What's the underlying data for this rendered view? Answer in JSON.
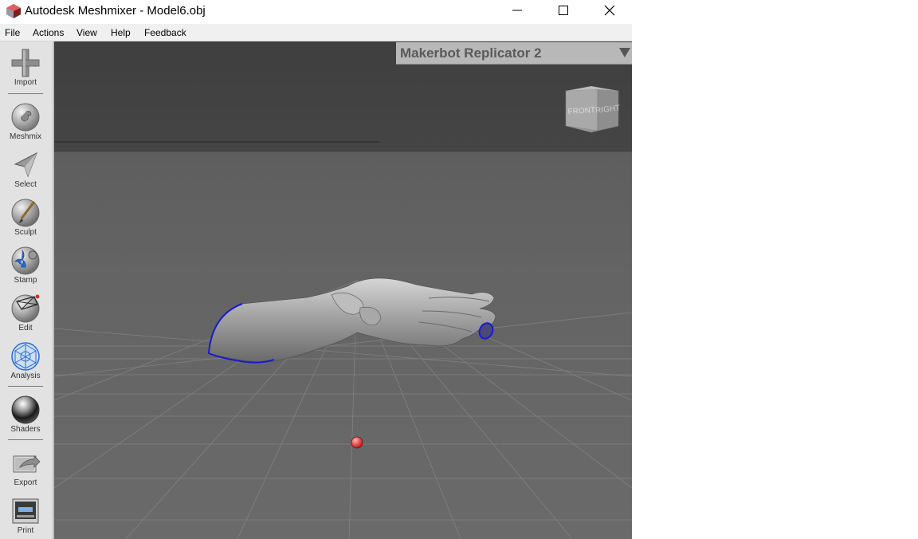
{
  "window": {
    "title": "Autodesk Meshmixer - Model6.obj",
    "controls": [
      "minimize-icon",
      "maximize-icon",
      "close-icon"
    ]
  },
  "menu": {
    "items": [
      "File",
      "Actions",
      "View",
      "Help",
      "Feedback"
    ]
  },
  "toolbar": {
    "tools": [
      {
        "label": "Import",
        "icon": "plus-icon"
      },
      {
        "label": "Meshmix",
        "icon": "bunny-sphere-icon"
      },
      {
        "label": "Select",
        "icon": "arrow-cursor-icon"
      },
      {
        "label": "Sculpt",
        "icon": "brush-sphere-icon"
      },
      {
        "label": "Stamp",
        "icon": "fleur-de-lis-icon"
      },
      {
        "label": "Edit",
        "icon": "mesh-edit-icon"
      },
      {
        "label": "Analysis",
        "icon": "geodesic-sphere-icon"
      },
      {
        "label": "Shaders",
        "icon": "chrome-sphere-icon"
      },
      {
        "label": "Export",
        "icon": "export-arrow-icon"
      },
      {
        "label": "Print",
        "icon": "printer-icon"
      }
    ]
  },
  "viewport": {
    "printer_selector": "Makerbot Replicator 2",
    "viewcube": {
      "face_front": "FRONT",
      "face_right": "RIGHT"
    },
    "model": "hand mesh",
    "boundary_color": "#1a1ad0",
    "pivot_color": "#e03030"
  }
}
